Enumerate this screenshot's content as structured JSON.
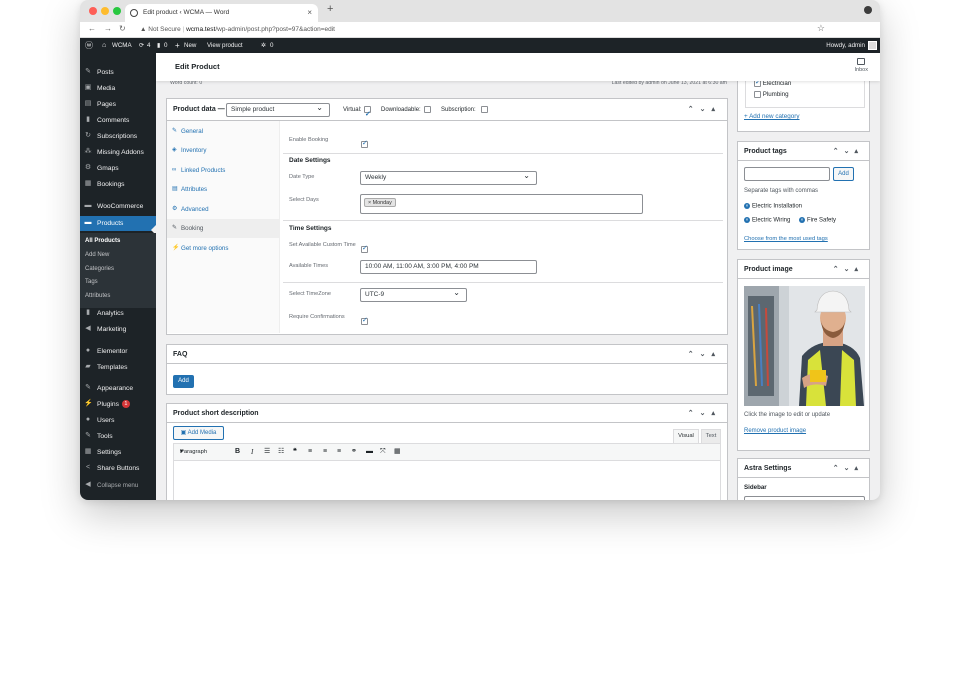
{
  "browser": {
    "tab_title": "Edit product ‹ WCMA — Word",
    "tab_close": "×",
    "new_tab": "+",
    "url_security": "Not Secure",
    "url_host": "wcma.test",
    "url_path": "/wp-admin/post.php?post=97&action=edit"
  },
  "adminbar": {
    "site_name": "WCMA",
    "updates": "4",
    "comments": "0",
    "new_label": "New",
    "view_product": "View product",
    "sync": "0",
    "howdy": "Howdy, admin"
  },
  "menu": {
    "items": [
      "Posts",
      "Media",
      "Pages",
      "Comments",
      "Subscriptions",
      "Missing Addons",
      "Gmaps",
      "Bookings",
      "WooCommerce",
      "Products",
      "Analytics",
      "Marketing",
      "Elementor",
      "Templates",
      "Appearance",
      "Plugins",
      "Users",
      "Tools",
      "Settings",
      "Share Buttons",
      "Collapse menu"
    ],
    "plugins_badge": "1",
    "submenu": [
      "All Products",
      "Add New",
      "Categories",
      "Tags",
      "Attributes"
    ]
  },
  "page": {
    "title": "Edit Product",
    "inbox": "Inbox",
    "word_count": "Word count: 0",
    "last_edited": "Last edited by admin on June 13, 2021 at 6:30 am"
  },
  "product_data": {
    "heading": "Product data —",
    "type_value": "Simple product",
    "virtual_label": "Virtual:",
    "downloadable_label": "Downloadable:",
    "subscription_label": "Subscription:",
    "tabs": [
      "General",
      "Inventory",
      "Linked Products",
      "Attributes",
      "Advanced",
      "Booking",
      "Get more options"
    ],
    "enable_booking_label": "Enable Booking",
    "date_settings": "Date Settings",
    "date_type_label": "Date Type",
    "date_type_value": "Weekly",
    "select_days_label": "Select Days",
    "selected_day": "× Monday",
    "time_settings": "Time Settings",
    "custom_time_label": "Set Available Custom Time",
    "available_times_label": "Available Times",
    "available_times_value": "10:00 AM, 11:00 AM, 3:00 PM, 4:00 PM",
    "timezone_label": "Select TimeZone",
    "timezone_value": "UTC-9",
    "require_confirm_label": "Require Confirmations"
  },
  "faq": {
    "heading": "FAQ",
    "add_button": "Add"
  },
  "short_desc": {
    "heading": "Product short description",
    "add_media": "Add Media",
    "visual_tab": "Visual",
    "text_tab": "Text",
    "paragraph": "Paragraph"
  },
  "categories": {
    "items": [
      "Electrician",
      "Plumbing"
    ],
    "add_new": "+ Add new category"
  },
  "tags": {
    "heading": "Product tags",
    "add_button": "Add",
    "hint": "Separate tags with commas",
    "items": [
      "Electric Installation",
      "Electric Wiring",
      "Fire Safety"
    ],
    "choose": "Choose from the most used tags"
  },
  "product_image": {
    "heading": "Product image",
    "hint": "Click the image to edit or update",
    "remove": "Remove product image"
  },
  "astra": {
    "heading": "Astra Settings",
    "sidebar_label": "Sidebar"
  }
}
